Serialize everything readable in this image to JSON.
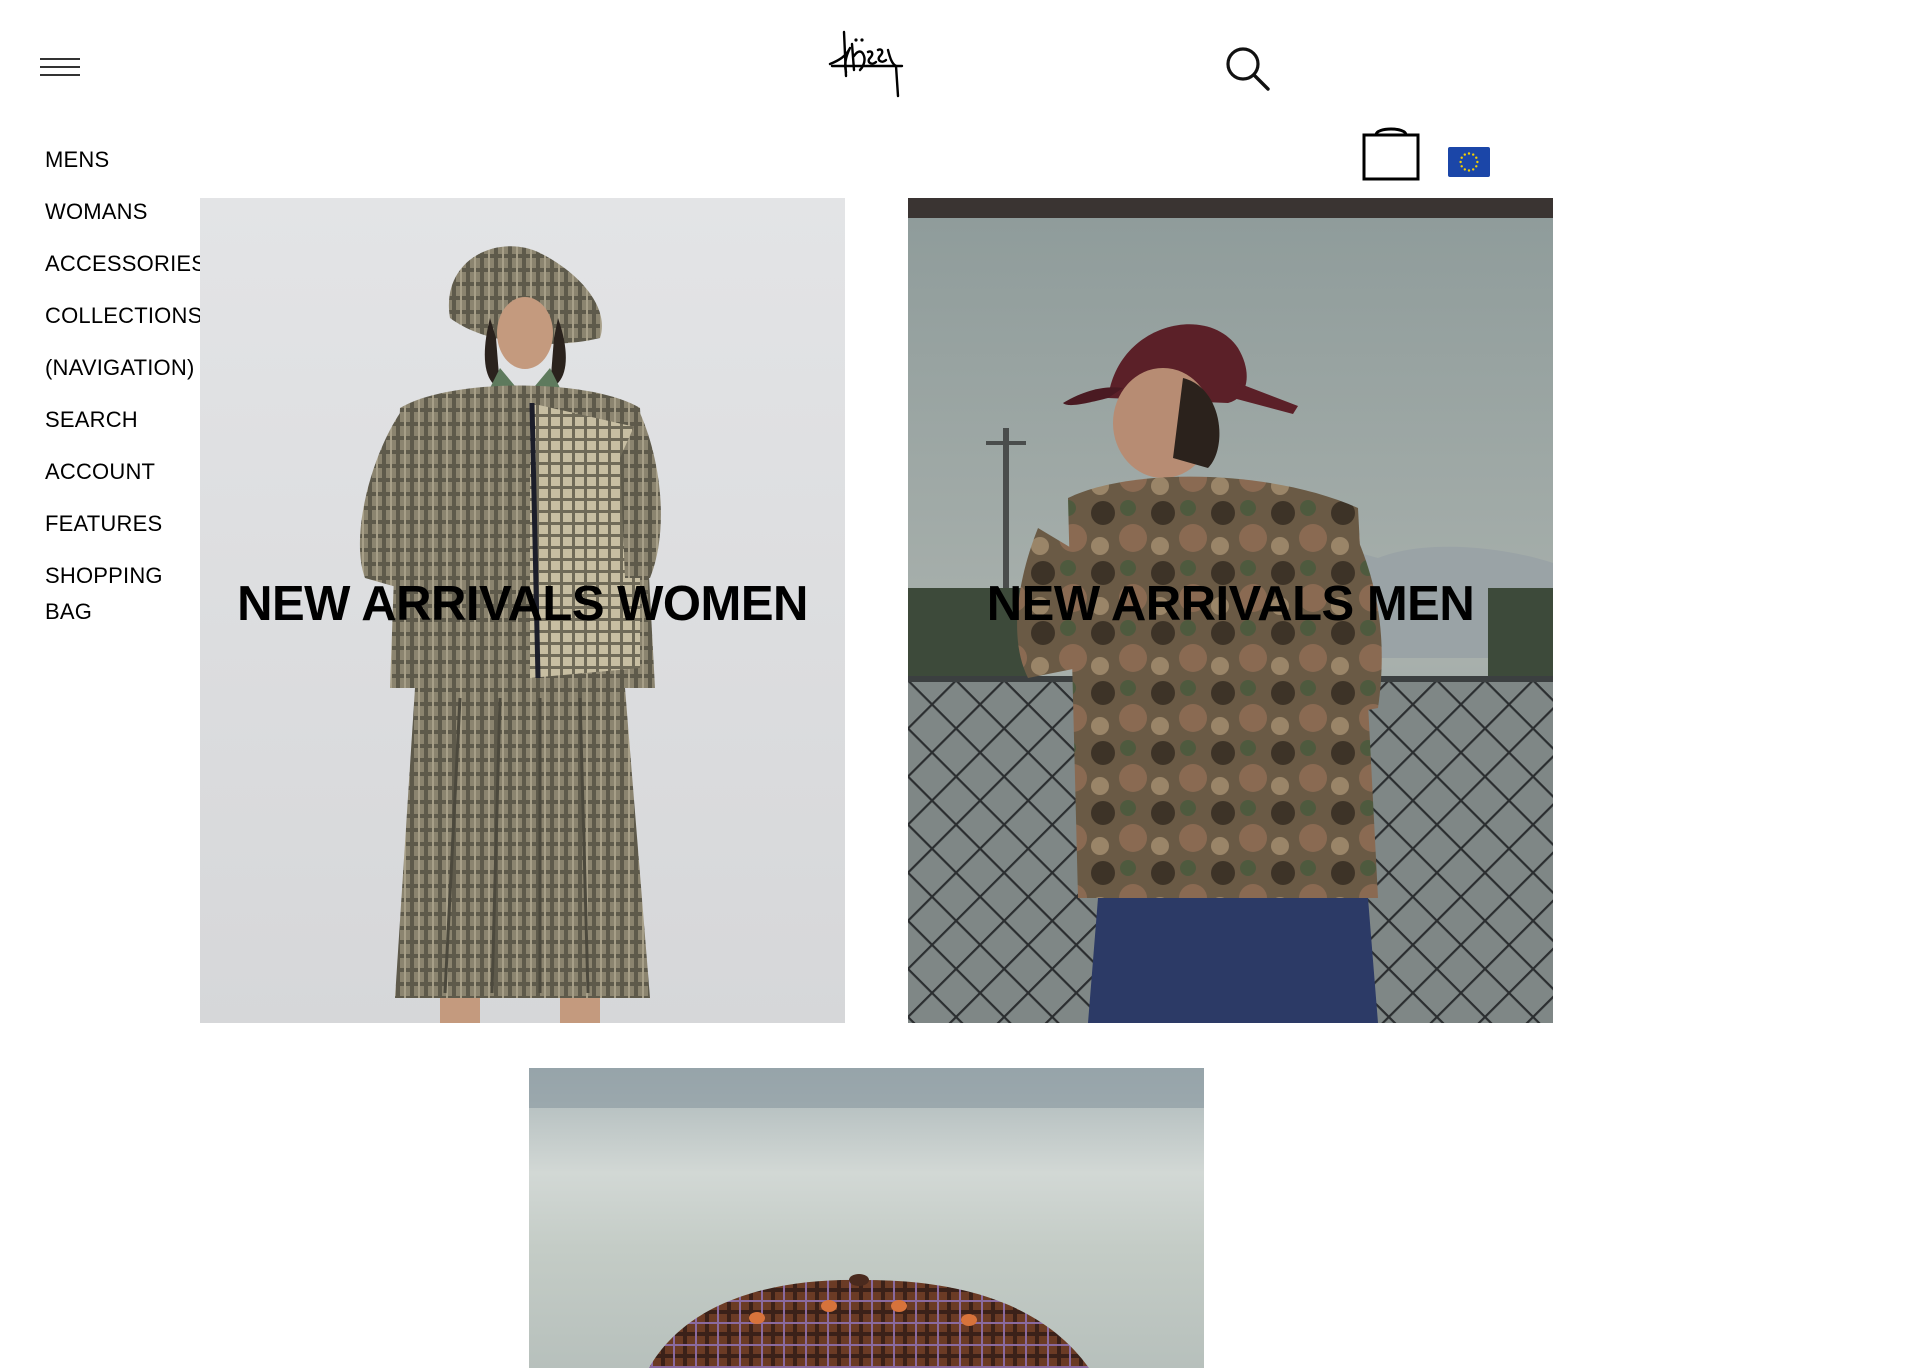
{
  "header": {
    "menu_icon": "hamburger-menu-icon",
    "logo_icon": "stussy-logo",
    "search_icon": "search-icon",
    "bag_icon": "shopping-bag-icon",
    "region_icon": "eu-flag-icon"
  },
  "nav": {
    "items": [
      {
        "label": "MENS"
      },
      {
        "label": "WOMANS"
      },
      {
        "label": "ACCESSORIES"
      },
      {
        "label": "COLLECTIONS"
      },
      {
        "label": "(NAVIGATION)"
      },
      {
        "label": "SEARCH"
      },
      {
        "label": "ACCOUNT"
      },
      {
        "label": "FEATURES"
      },
      {
        "label": "SHOPPING BAG"
      }
    ]
  },
  "tiles": {
    "women": {
      "title": "NEW ARRIVALS WOMEN"
    },
    "men": {
      "title": "NEW ARRIVALS MEN"
    },
    "bottom": {
      "title": ""
    }
  },
  "colors": {
    "flag_blue": "#1b46a8",
    "flag_stars": "#f5d000"
  }
}
